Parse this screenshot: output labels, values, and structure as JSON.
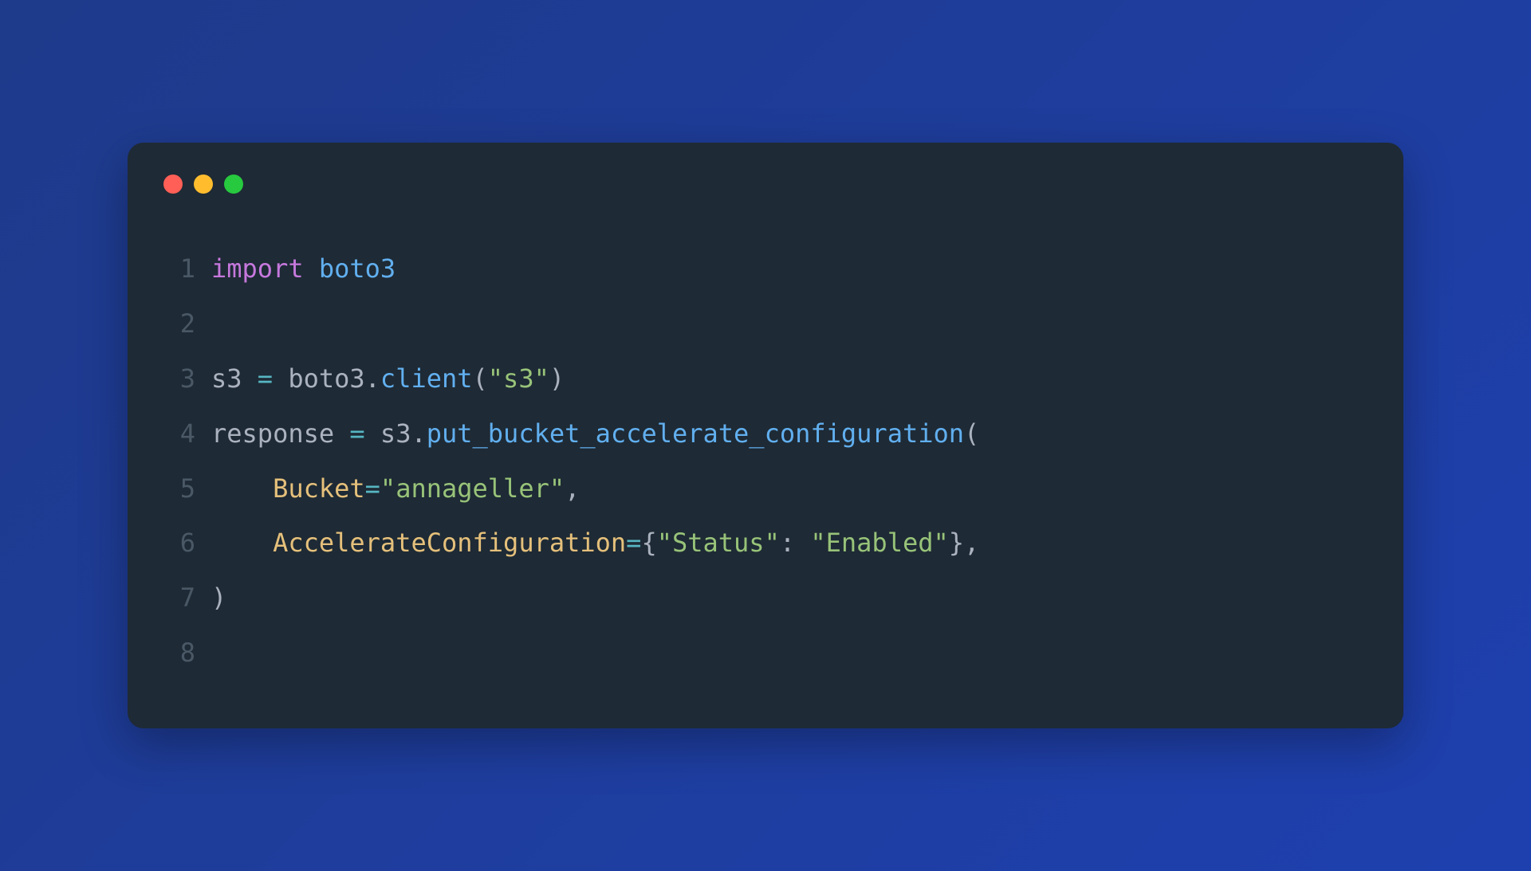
{
  "colors": {
    "bg_gradient_start": "#1e3a8a",
    "bg_gradient_end": "#1e40af",
    "editor_bg": "#1e2a35",
    "close": "#ff5f56",
    "minimize": "#ffbd2e",
    "maximize": "#27c93f",
    "line_number": "#4a5866",
    "keyword": "#c678dd",
    "default": "#abb2bf",
    "operator": "#56b6c2",
    "method": "#61afef",
    "string": "#98c379",
    "param": "#e5c07b"
  },
  "code": {
    "lines": [
      {
        "num": "1",
        "tokens": [
          {
            "t": "import",
            "c": "keyword"
          },
          {
            "t": " ",
            "c": "default"
          },
          {
            "t": "boto3",
            "c": "method"
          }
        ]
      },
      {
        "num": "2",
        "tokens": []
      },
      {
        "num": "3",
        "tokens": [
          {
            "t": "s3 ",
            "c": "default"
          },
          {
            "t": "=",
            "c": "operator"
          },
          {
            "t": " boto3",
            "c": "default"
          },
          {
            "t": ".",
            "c": "default"
          },
          {
            "t": "client",
            "c": "method"
          },
          {
            "t": "(",
            "c": "default"
          },
          {
            "t": "\"s3\"",
            "c": "string"
          },
          {
            "t": ")",
            "c": "default"
          }
        ]
      },
      {
        "num": "4",
        "tokens": [
          {
            "t": "response ",
            "c": "default"
          },
          {
            "t": "=",
            "c": "operator"
          },
          {
            "t": " s3",
            "c": "default"
          },
          {
            "t": ".",
            "c": "default"
          },
          {
            "t": "put_bucket_accelerate_configuration",
            "c": "method"
          },
          {
            "t": "(",
            "c": "default"
          }
        ]
      },
      {
        "num": "5",
        "tokens": [
          {
            "t": "    ",
            "c": "default"
          },
          {
            "t": "Bucket",
            "c": "param"
          },
          {
            "t": "=",
            "c": "operator"
          },
          {
            "t": "\"annageller\"",
            "c": "string"
          },
          {
            "t": ",",
            "c": "default"
          }
        ]
      },
      {
        "num": "6",
        "tokens": [
          {
            "t": "    ",
            "c": "default"
          },
          {
            "t": "AccelerateConfiguration",
            "c": "param"
          },
          {
            "t": "=",
            "c": "operator"
          },
          {
            "t": "{",
            "c": "default"
          },
          {
            "t": "\"Status\"",
            "c": "string"
          },
          {
            "t": ": ",
            "c": "default"
          },
          {
            "t": "\"Enabled\"",
            "c": "string"
          },
          {
            "t": "}",
            "c": "default"
          },
          {
            "t": ",",
            "c": "default"
          }
        ]
      },
      {
        "num": "7",
        "tokens": [
          {
            "t": ")",
            "c": "default"
          }
        ]
      },
      {
        "num": "8",
        "tokens": []
      }
    ]
  }
}
